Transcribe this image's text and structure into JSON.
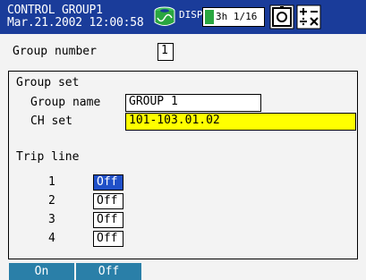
{
  "header": {
    "title": "CONTROL GROUP1",
    "datetime": "Mar.21.2002 12:00:58",
    "disp_label": "DISP",
    "batch_text": "3h 1/16",
    "icons": [
      "disk-icon",
      "camera-icon",
      "math-icon"
    ]
  },
  "group_number": {
    "label": "Group number",
    "value": "1"
  },
  "group_set": {
    "title": "Group set",
    "group_name_label": "Group name",
    "group_name_value": "GROUP 1",
    "ch_set_label": "CH set",
    "ch_set_value": "101-103.01.02"
  },
  "trip_line": {
    "title": "Trip line",
    "rows": [
      {
        "num": "1",
        "value": "Off"
      },
      {
        "num": "2",
        "value": "Off"
      },
      {
        "num": "3",
        "value": "Off"
      },
      {
        "num": "4",
        "value": "Off"
      }
    ]
  },
  "softkeys": [
    {
      "label": "On"
    },
    {
      "label": "Off"
    }
  ],
  "colors": {
    "header_bg": "#1a3c9a",
    "highlight": "#ffff00",
    "selected": "#2050c8",
    "softkey_bg": "#2a7fa8"
  }
}
